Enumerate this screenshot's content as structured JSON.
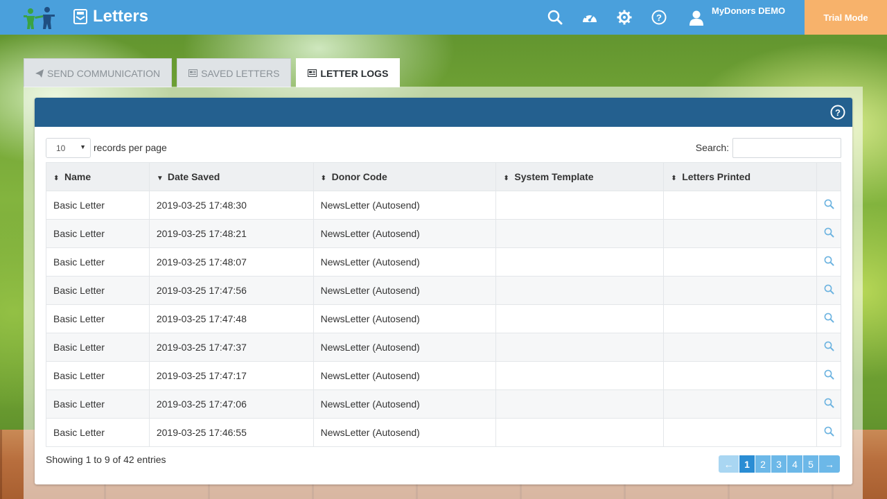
{
  "app": {
    "title": "Letters",
    "user": "MyDonors DEMO",
    "trial": "Trial Mode"
  },
  "tabs": [
    {
      "label": "SEND COMMUNICATION",
      "icon": "paper-plane-icon",
      "active": false
    },
    {
      "label": "SAVED LETTERS",
      "icon": "newspaper-icon",
      "active": false
    },
    {
      "label": "LETTER LOGS",
      "icon": "newspaper-icon",
      "active": true
    }
  ],
  "controls": {
    "page_length": "10",
    "page_length_label": "records per page",
    "search_label": "Search:",
    "search_value": ""
  },
  "table": {
    "columns": [
      "Name",
      "Date Saved",
      "Donor Code",
      "System Template",
      "Letters Printed"
    ],
    "rows": [
      {
        "name": "Basic Letter",
        "date": "2019-03-25 17:48:30",
        "donor_code": "NewsLetter (Autosend)",
        "template": "",
        "printed": ""
      },
      {
        "name": "Basic Letter",
        "date": "2019-03-25 17:48:21",
        "donor_code": "NewsLetter (Autosend)",
        "template": "",
        "printed": ""
      },
      {
        "name": "Basic Letter",
        "date": "2019-03-25 17:48:07",
        "donor_code": "NewsLetter (Autosend)",
        "template": "",
        "printed": ""
      },
      {
        "name": "Basic Letter",
        "date": "2019-03-25 17:47:56",
        "donor_code": "NewsLetter (Autosend)",
        "template": "",
        "printed": ""
      },
      {
        "name": "Basic Letter",
        "date": "2019-03-25 17:47:48",
        "donor_code": "NewsLetter (Autosend)",
        "template": "",
        "printed": ""
      },
      {
        "name": "Basic Letter",
        "date": "2019-03-25 17:47:37",
        "donor_code": "NewsLetter (Autosend)",
        "template": "",
        "printed": ""
      },
      {
        "name": "Basic Letter",
        "date": "2019-03-25 17:47:17",
        "donor_code": "NewsLetter (Autosend)",
        "template": "",
        "printed": ""
      },
      {
        "name": "Basic Letter",
        "date": "2019-03-25 17:47:06",
        "donor_code": "NewsLetter (Autosend)",
        "template": "",
        "printed": ""
      },
      {
        "name": "Basic Letter",
        "date": "2019-03-25 17:46:55",
        "donor_code": "NewsLetter (Autosend)",
        "template": "",
        "printed": ""
      }
    ]
  },
  "footer": {
    "info": "Showing 1 to 9 of 42 entries",
    "prev": "←",
    "next": "→",
    "pages": [
      "1",
      "2",
      "3",
      "4",
      "5"
    ],
    "current_page": "1"
  },
  "colors": {
    "topbar": "#4aa0dc",
    "trial": "#f7b26b",
    "panel_header": "#24608f",
    "page_active": "#2a8dd4",
    "view_icon": "#6cb3e0"
  }
}
